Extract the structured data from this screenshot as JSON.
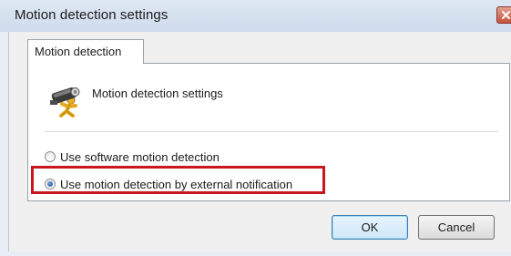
{
  "window": {
    "title": "Motion detection settings"
  },
  "tabs": [
    {
      "label": "Motion detection",
      "selected": true
    }
  ],
  "panel": {
    "header_icon": "camera-motion-icon",
    "header_text": "Motion detection settings",
    "options": [
      {
        "label": "Use software motion detection",
        "selected": false
      },
      {
        "label": "Use motion detection by external notification",
        "selected": true
      }
    ]
  },
  "buttons": {
    "ok_label": "OK",
    "cancel_label": "Cancel"
  },
  "colors": {
    "highlight": "#c8181e",
    "title_bar": "#dde7f3",
    "dialog_bg": "#f0f0f0",
    "close_button": "#c6513a"
  }
}
